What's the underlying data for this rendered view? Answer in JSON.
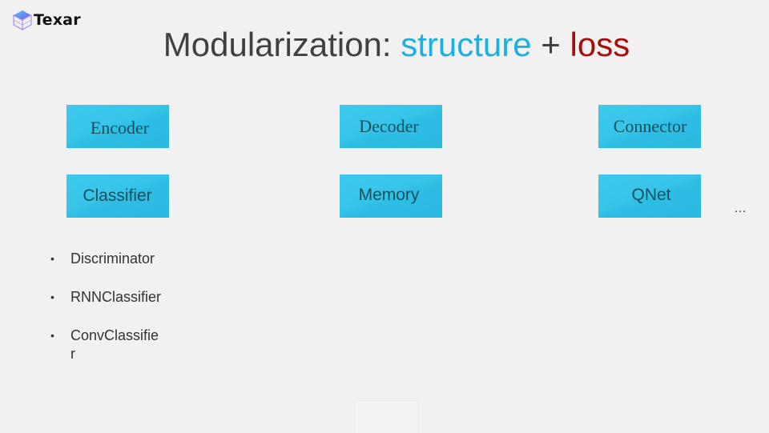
{
  "logo": {
    "icon": "texar-cube-icon",
    "text": "Texar"
  },
  "title": {
    "prefix": "Modularization: ",
    "structure": "structure",
    "plus": " + ",
    "loss": "loss"
  },
  "colors": {
    "structure": "#1ab0e0",
    "loss": "#a80d0d",
    "module_box": "#33c2e6",
    "module_text": "#16505e"
  },
  "modules": [
    {
      "label": "Encoder"
    },
    {
      "label": "Decoder"
    },
    {
      "label": "Connector"
    },
    {
      "label": "Classifier"
    },
    {
      "label": "Memory"
    },
    {
      "label": "QNet"
    }
  ],
  "more": "…",
  "classifier_list": [
    {
      "label": "Discriminator"
    },
    {
      "label": "RNNClassifier"
    },
    {
      "label": "ConvClassifier"
    }
  ],
  "bullet": "•"
}
